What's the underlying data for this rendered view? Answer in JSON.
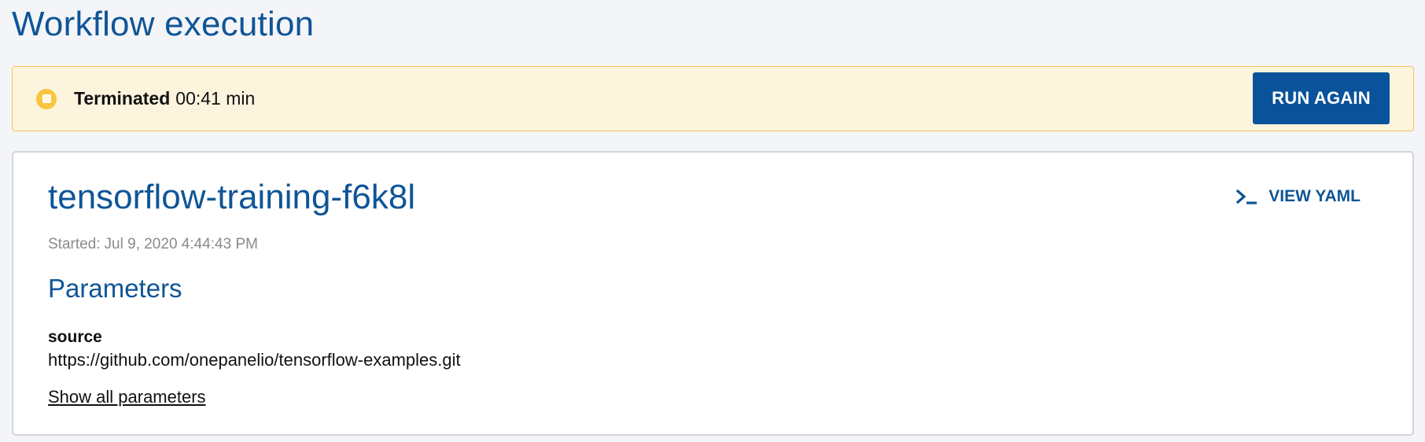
{
  "header": {
    "title": "Workflow execution"
  },
  "status": {
    "label": "Terminated",
    "duration": "00:41 min",
    "run_again_label": "RUN AGAIN",
    "icon": "stop-circle-icon",
    "color": "#f9c53e"
  },
  "workflow": {
    "name": "tensorflow-training-f6k8l",
    "started_prefix": "Started:",
    "started_value": "Jul 9, 2020 4:44:43 PM",
    "view_yaml_label": "VIEW YAML",
    "view_yaml_icon": "terminal-icon",
    "parameters_heading": "Parameters",
    "parameters": [
      {
        "name": "source",
        "value": "https://github.com/onepanelio/tensorflow-examples.git"
      }
    ],
    "show_all_label": "Show all parameters"
  },
  "colors": {
    "brand_blue": "#0f5596",
    "button_blue": "#0a539a",
    "banner_bg": "#fdf4de",
    "banner_border": "#f4c356"
  }
}
